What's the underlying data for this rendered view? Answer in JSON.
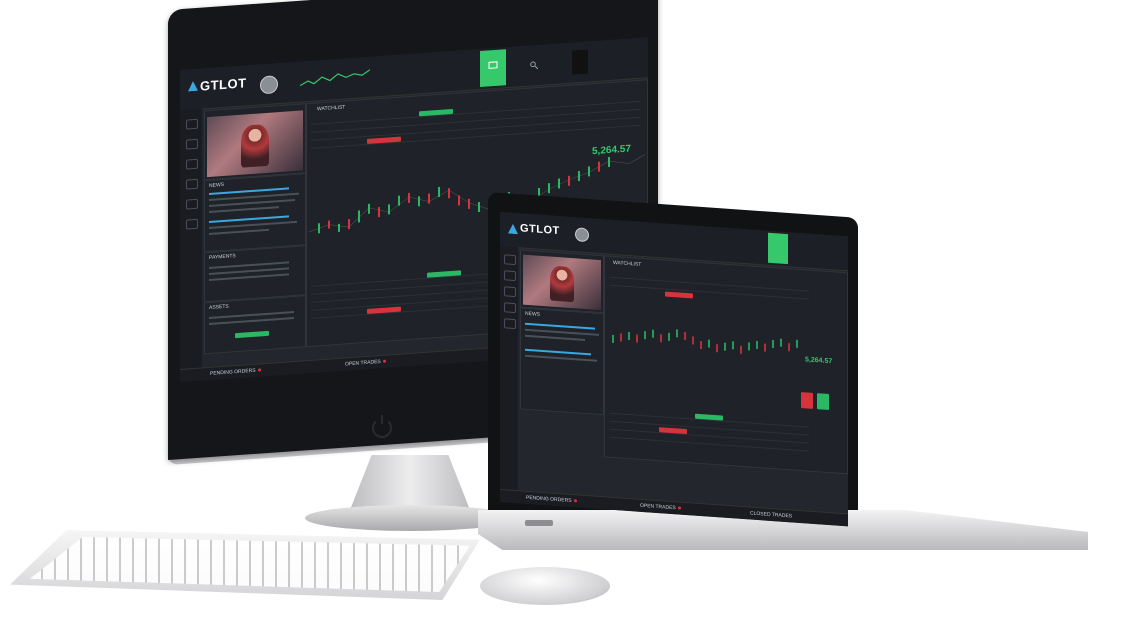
{
  "brand": "GTLOT",
  "colors": {
    "buy": "#2bb865",
    "sell": "#d6333c",
    "accent": "#35c96b",
    "background": "#23262d"
  },
  "imac": {
    "watchlist_title": "WATCHLIST",
    "news_title": "NEWS",
    "payments_title": "PAYMENTS",
    "assets_title": "ASSETS",
    "current_price": "5,264.57",
    "bottom_tabs": [
      "PENDING ORDERS",
      "OPEN TRADES"
    ]
  },
  "laptop": {
    "watchlist_title": "WATCHLIST",
    "news_title": "NEWS",
    "current_price": "5,264.57",
    "bottom_tabs": [
      "PENDING ORDERS",
      "OPEN TRADES",
      "CLOSED TRADES"
    ]
  },
  "icons": [
    "logo-triangle-icon",
    "power-icon",
    "deposit-icon",
    "search-icon",
    "chart-candles-icon"
  ]
}
